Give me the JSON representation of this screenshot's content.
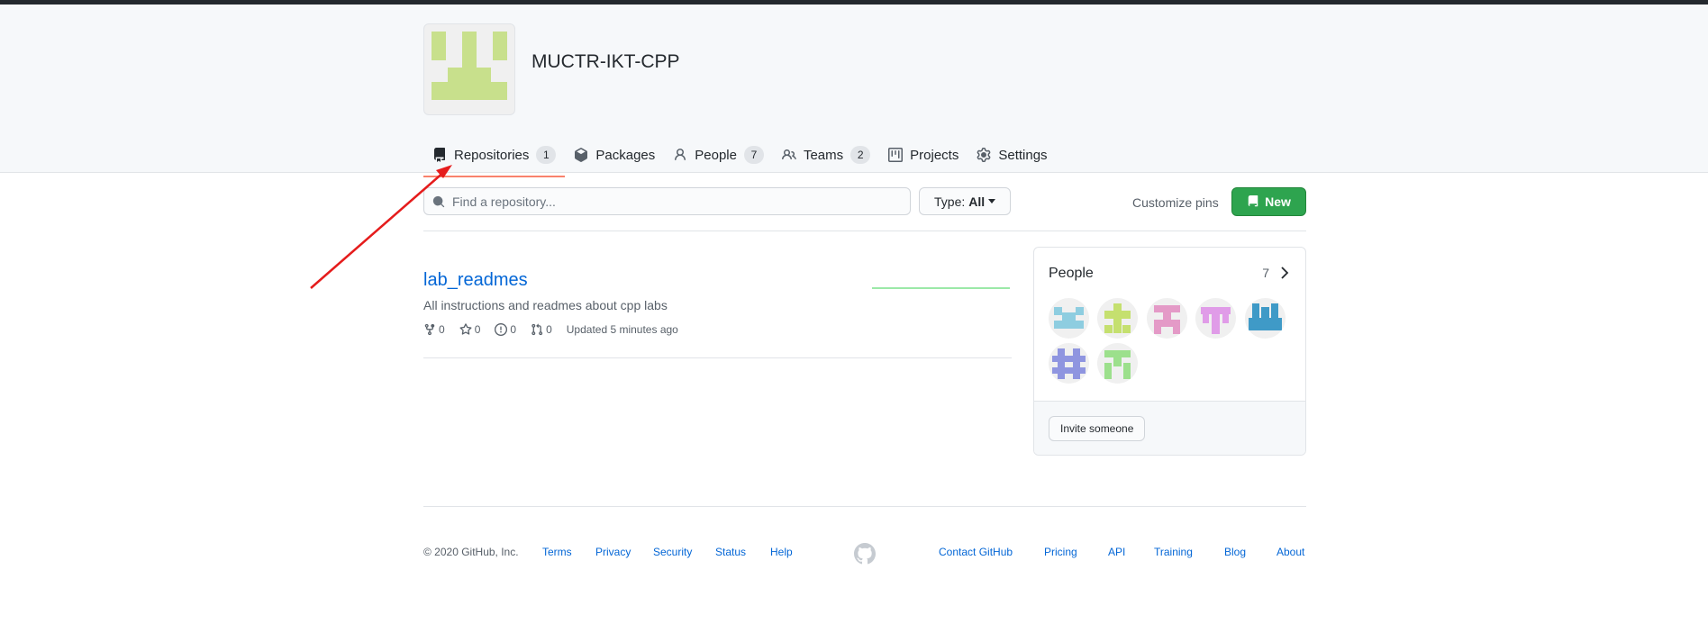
{
  "org": {
    "name": "MUCTR-IKT-CPP",
    "avatar_color": "#c8e08c"
  },
  "tabs": [
    {
      "label": "Repositories",
      "count": "1",
      "icon": "repo-icon"
    },
    {
      "label": "Packages",
      "icon": "package-icon"
    },
    {
      "label": "People",
      "count": "7",
      "icon": "person-icon"
    },
    {
      "label": "Teams",
      "count": "2",
      "icon": "people-icon"
    },
    {
      "label": "Projects",
      "icon": "project-icon"
    },
    {
      "label": "Settings",
      "icon": "gear-icon"
    }
  ],
  "toolbar": {
    "search_placeholder": "Find a repository...",
    "type_label": "Type:",
    "type_value": "All",
    "customize_pins": "Customize pins",
    "new_label": "New"
  },
  "repos": [
    {
      "name": "lab_readmes",
      "description": "All instructions and readmes about cpp labs",
      "forks": "0",
      "stars": "0",
      "issues": "0",
      "pull_requests": "0",
      "updated": "Updated 5 minutes ago"
    }
  ],
  "people": {
    "title": "People",
    "count": "7",
    "invite_label": "Invite someone",
    "avatar_colors": [
      "#8ecde0",
      "#c5e06f",
      "#e49ac7",
      "#e09ce8",
      "#3f9ac7",
      "#8f95e0",
      "#9ce08c"
    ]
  },
  "footer": {
    "copyright": "© 2020 GitHub, Inc.",
    "links_left": [
      "Terms",
      "Privacy",
      "Security",
      "Status",
      "Help"
    ],
    "links_right": [
      "Contact GitHub",
      "Pricing",
      "API",
      "Training",
      "Blog",
      "About"
    ]
  },
  "colors": {
    "accent_link": "#0366d6",
    "new_button": "#2ea44f",
    "selected_tab_underline": "#f9826c",
    "annotation_arrow": "#e51c1c"
  }
}
